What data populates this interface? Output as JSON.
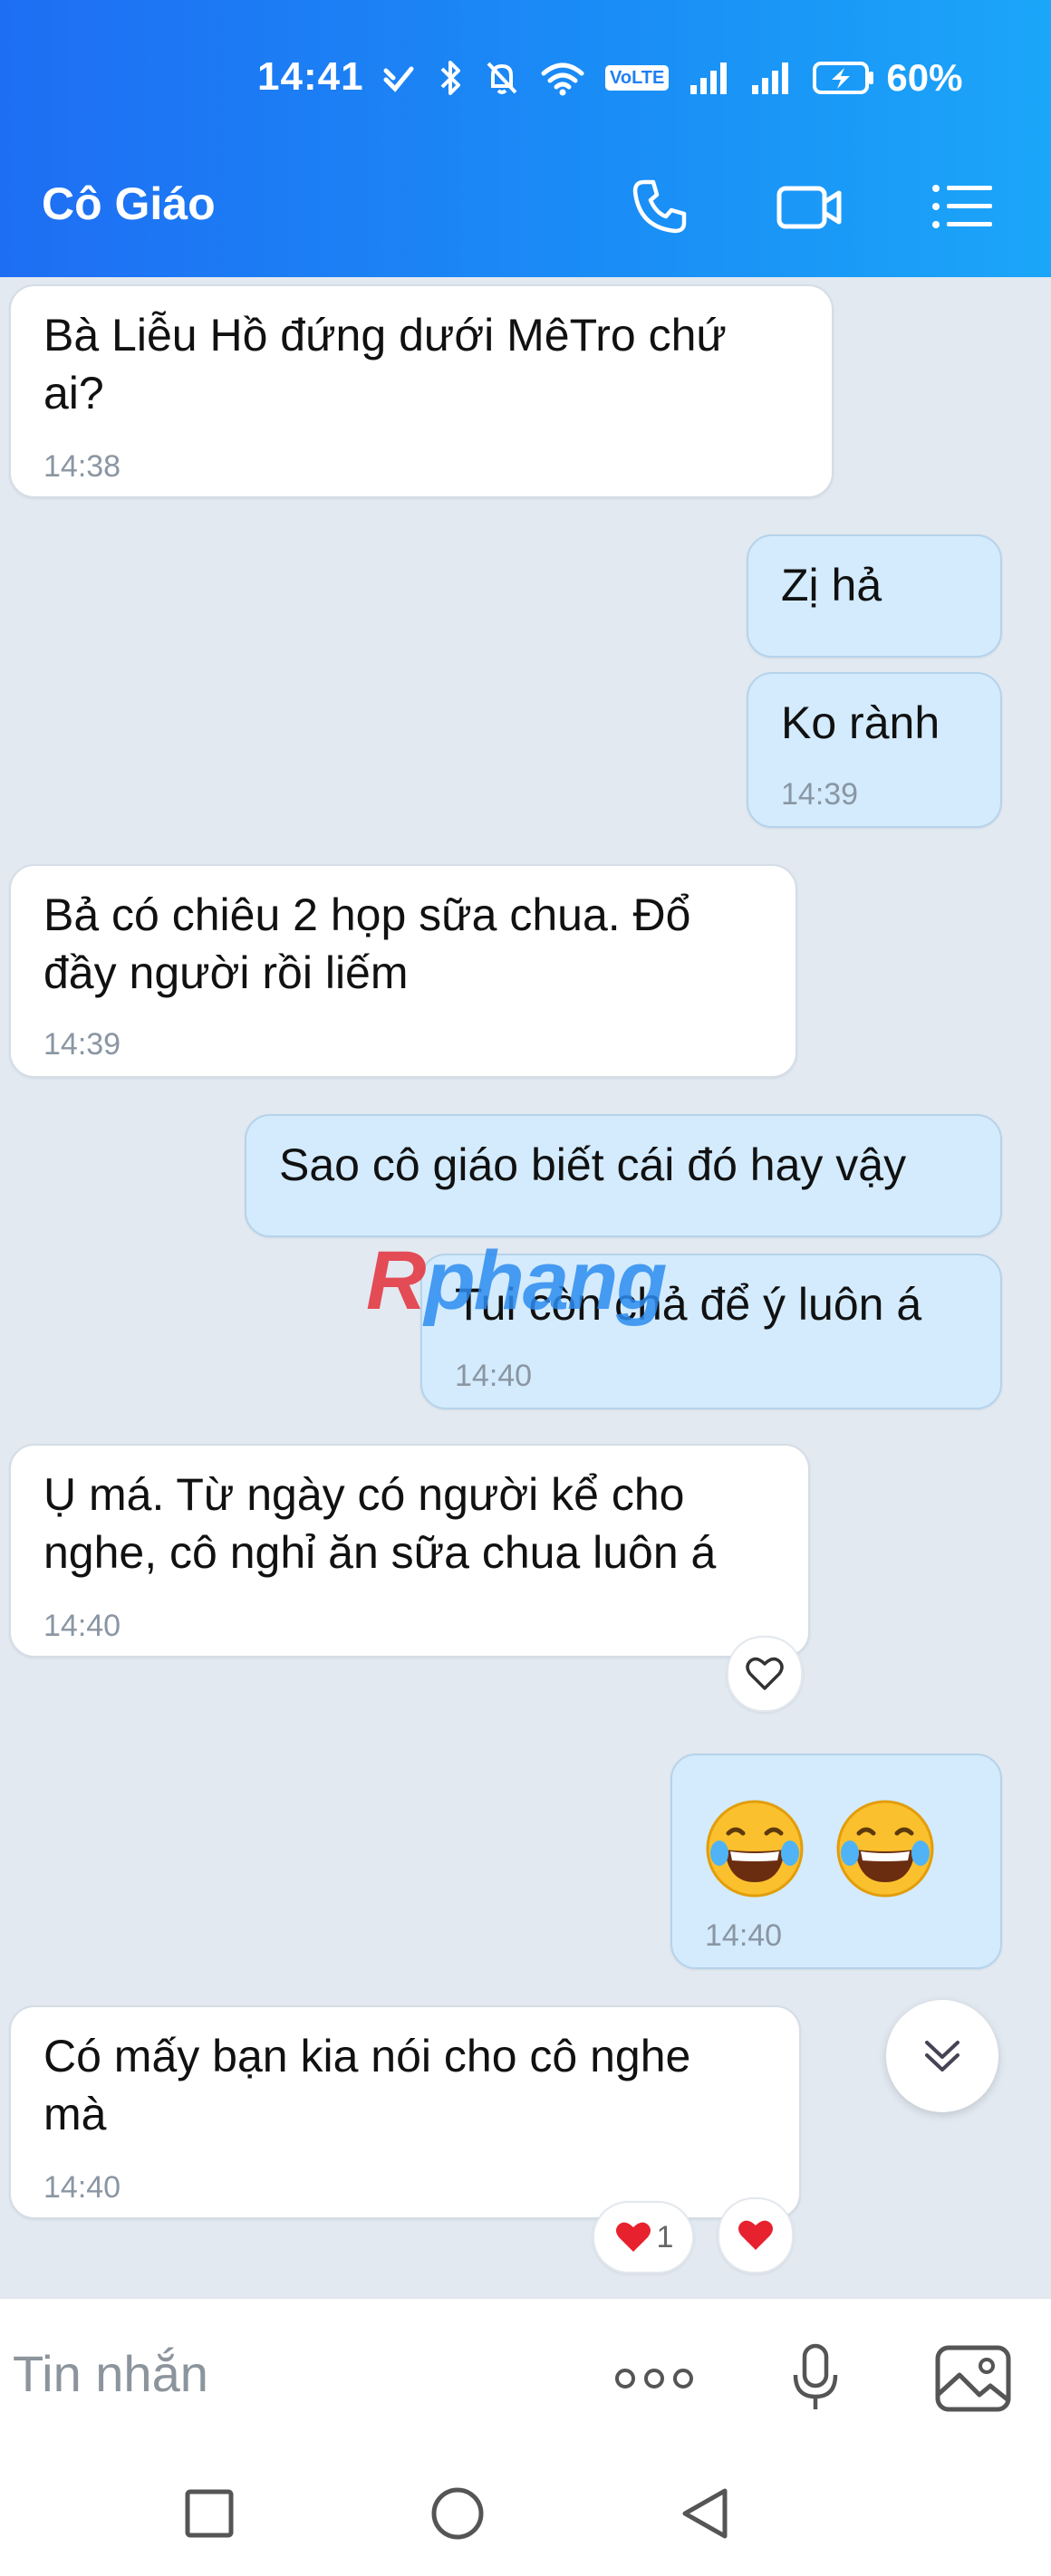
{
  "status_bar": {
    "time": "14:41",
    "battery": "60%",
    "volte": "VoLTE",
    "icons": [
      "wifi-calling-icon",
      "bluetooth-icon",
      "mute-icon",
      "wifi-icon",
      "volte-icon",
      "signal-icon",
      "signal-icon",
      "battery-charging-icon"
    ]
  },
  "header": {
    "title": "Cô Giáo",
    "actions": [
      "phone-icon",
      "video-call-icon",
      "menu-list-icon"
    ]
  },
  "messages": [
    {
      "side": "in",
      "lines": [
        "Bà Liễu Hồ đứng dưới MêTro chứ",
        "ai?"
      ],
      "time": "14:38"
    },
    {
      "side": "out",
      "lines": [
        "Zị hả"
      ],
      "time": ""
    },
    {
      "side": "out",
      "lines": [
        "Ko rành"
      ],
      "time": "14:39"
    },
    {
      "side": "in",
      "lines": [
        "Bả có chiêu 2 họp sữa chua. Đổ",
        "đầy người rồi liếm"
      ],
      "time": "14:39"
    },
    {
      "side": "out",
      "lines": [
        "Sao cô giáo biết cái đó hay vậy"
      ],
      "time": ""
    },
    {
      "side": "out",
      "lines": [
        "Tui còn chả để ý luôn á"
      ],
      "time": "14:40"
    },
    {
      "side": "in",
      "lines": [
        "Ụ má. Từ ngày có người kể cho",
        "nghe, cô nghỉ ăn sữa chua luôn á"
      ],
      "time": "14:40"
    },
    {
      "side": "out",
      "lines": [],
      "emoji": [
        "😂",
        "😂"
      ],
      "time": "14:40"
    },
    {
      "side": "in",
      "lines": [
        "Có mấy bạn kia nói cho cô nghe",
        "mà"
      ],
      "time": "14:40"
    }
  ],
  "reactions": {
    "msg7": "heart-outline-icon",
    "msg9_count": "1"
  },
  "watermark": {
    "part1": "R",
    "part2": "phang"
  },
  "input": {
    "placeholder": "Tin nhắn"
  },
  "colors": {
    "header_start": "#1e6ef3",
    "header_end": "#1ba6f9",
    "background": "#e2e9f1",
    "bubble_in": "#ffffff",
    "bubble_out": "#d3ebfd",
    "heart": "#e8212e"
  }
}
